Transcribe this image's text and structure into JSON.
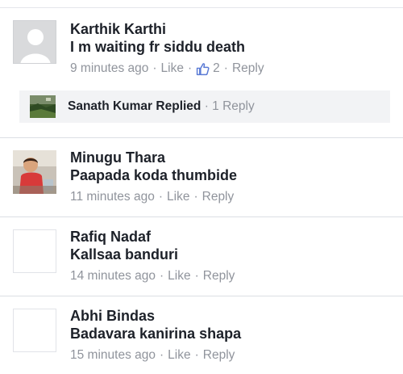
{
  "comments": [
    {
      "name": "Karthik Karthi",
      "text": "I m waiting fr siddu death",
      "time": "9 minutes ago",
      "like": "Like",
      "likes_count": "2",
      "reply": "Reply",
      "avatar": "default-silhouette"
    },
    {
      "name": "Minugu Thara",
      "text": "Paapada koda thumbide",
      "time": "11 minutes ago",
      "like": "Like",
      "reply": "Reply",
      "avatar": "child-photo"
    },
    {
      "name": "Rafiq Nadaf",
      "text": "Kallsaa banduri",
      "time": "14 minutes ago",
      "like": "Like",
      "reply": "Reply",
      "avatar": "blank"
    },
    {
      "name": "Abhi Bindas",
      "text": "Badavara kanirina shapa",
      "time": "15 minutes ago",
      "like": "Like",
      "reply": "Reply",
      "avatar": "blank"
    }
  ],
  "reply_summary": {
    "name": "Sanath Kumar",
    "action": "Replied",
    "count_label": "1 Reply"
  },
  "icons": {
    "like": "thumbs-up-icon"
  },
  "colors": {
    "text": "#1d2129",
    "muted": "#90949c",
    "like_icon": "#5b7bd5",
    "reply_bar_bg": "#f2f3f5"
  }
}
